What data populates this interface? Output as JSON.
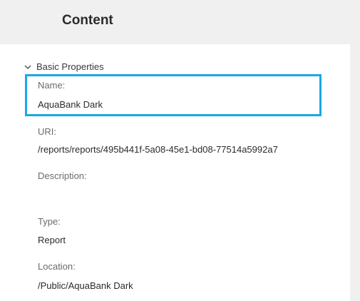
{
  "header": {
    "title": "Content"
  },
  "section": {
    "label": "Basic Properties",
    "icon": "chevron-down-icon"
  },
  "fields": {
    "name": {
      "label": "Name:",
      "value": "AquaBank Dark"
    },
    "uri": {
      "label": "URI:",
      "value": "/reports/reports/495b441f-5a08-45e1-bd08-77514a5992a7"
    },
    "description": {
      "label": "Description:",
      "value": ""
    },
    "type": {
      "label": "Type:",
      "value": "Report"
    },
    "location": {
      "label": "Location:",
      "value": "/Public/AquaBank Dark"
    }
  },
  "colors": {
    "highlight": "#1aa7e6"
  }
}
